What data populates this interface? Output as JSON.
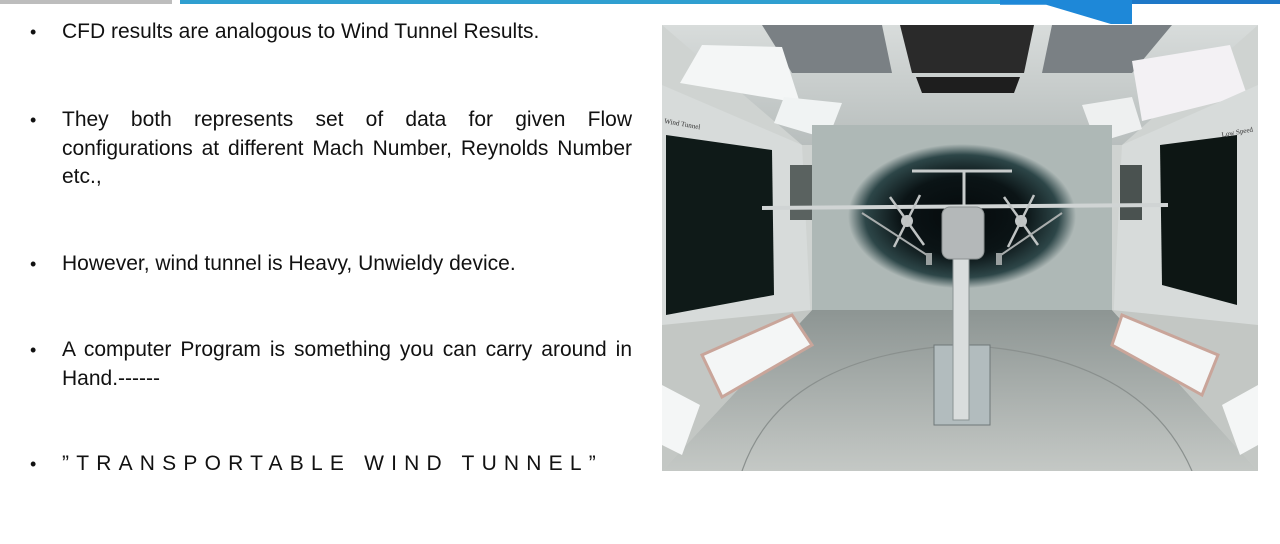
{
  "slide": {
    "bullets": [
      {
        "bullet_glyph": "•",
        "text": "CFD results are analogous to Wind Tunnel Results."
      },
      {
        "bullet_glyph": "•",
        "text": "They both represents set of data for given Flow configurations at different Mach Number, Reynolds Number etc.,"
      },
      {
        "bullet_glyph": "•",
        "text": "However, wind tunnel is  Heavy, Unwieldy device."
      },
      {
        "bullet_glyph": "•",
        "text": "A computer Program is something you can carry around in Hand.------"
      },
      {
        "bullet_glyph": "•",
        "text": "”TRANSPORTABLE WIND TUNNEL”"
      }
    ],
    "image": {
      "description": "Interior of a low-speed wind tunnel test section with a twin-turboprop aircraft model mounted on a sting",
      "wall_labels": [
        "Wind Tunnel",
        "Low Speed"
      ]
    },
    "colors": {
      "accent_blue": "#2f9fd0",
      "tab_blue": "#1e88d8",
      "bar_gray": "#bdbdbd"
    }
  }
}
